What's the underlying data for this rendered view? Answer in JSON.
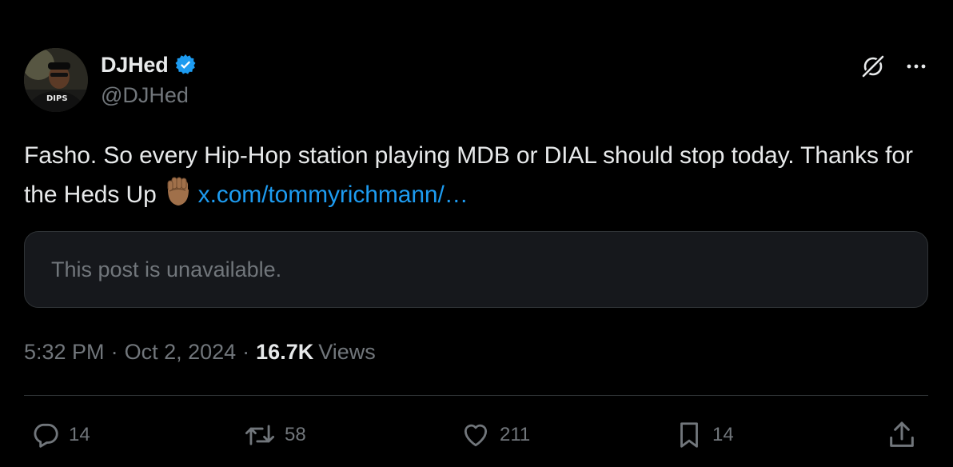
{
  "author": {
    "display_name": "DJHed",
    "handle": "@DJHed",
    "avatar_text": "DIPS"
  },
  "post": {
    "text": "Fasho. So every Hip-Hop station playing MDB or DIAL should stop today. Thanks for the Heds Up",
    "emoji": "raised-fist-medium-dark-skin-tone",
    "link_text": "x.com/tommyrichmann/…"
  },
  "quoted_post": {
    "text": "This post is unavailable."
  },
  "meta": {
    "time": "5:32 PM",
    "separator": "·",
    "date": "Oct 2, 2024",
    "views_count": "16.7K",
    "views_label": "Views"
  },
  "actions": {
    "replies": "14",
    "reposts": "58",
    "likes": "211",
    "bookmarks": "14"
  },
  "colors": {
    "background": "#000000",
    "text_primary": "#e7e9ea",
    "text_secondary": "#71767b",
    "link": "#1d9bf0",
    "verified": "#1d9bf0",
    "border": "#2f3336",
    "card_bg": "#16181c"
  },
  "icons": {
    "verified": "verified-badge-icon",
    "grok": "grok-icon",
    "more": "more-horizontal-icon",
    "reply": "reply-icon",
    "repost": "repost-icon",
    "like": "heart-icon",
    "bookmark": "bookmark-icon",
    "share": "share-icon"
  }
}
